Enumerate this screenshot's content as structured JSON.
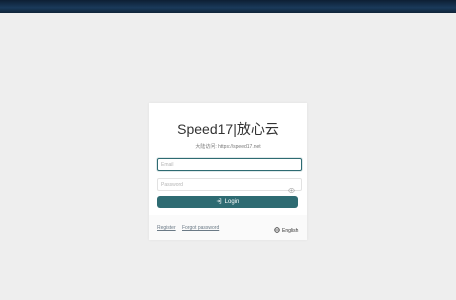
{
  "card": {
    "title": "Speed17|放心云",
    "subtitle": "大陆访问: https://speed17.net"
  },
  "form": {
    "email_placeholder": "Email",
    "email_value": "",
    "password_placeholder": "Password",
    "password_value": "",
    "login_label": "Login"
  },
  "footer": {
    "register_label": "Register",
    "forgot_label": "Forgot password",
    "language_label": "English"
  },
  "icons": {
    "login": "login-icon",
    "eye": "eye-icon",
    "globe": "globe-icon"
  },
  "colors": {
    "accent": "#2e6b72",
    "header": "#0d1f33"
  }
}
